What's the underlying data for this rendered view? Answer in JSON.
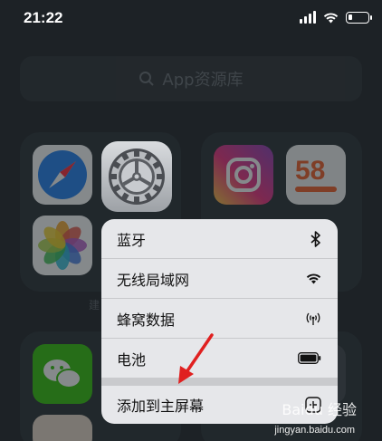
{
  "status_bar": {
    "time": "21:22"
  },
  "search": {
    "placeholder": "App资源库"
  },
  "folder_labels": {
    "left_partial": "建"
  },
  "menu": {
    "items": [
      {
        "label": "蓝牙",
        "icon": "bluetooth-icon"
      },
      {
        "label": "无线局域网",
        "icon": "wifi-icon"
      },
      {
        "label": "蜂窝数据",
        "icon": "cellular-icon"
      },
      {
        "label": "电池",
        "icon": "battery-icon"
      },
      {
        "label": "添加到主屏幕",
        "icon": "add-to-home-icon"
      }
    ]
  },
  "annotation": {
    "arrow_color": "#e02020"
  },
  "watermark": {
    "text": "Baidu 经验",
    "url": "jingyan.baidu.com"
  },
  "icons": {
    "safari": "safari-icon",
    "photos": "photos-icon",
    "instagram": "instagram-icon",
    "app58": "58-icon",
    "wechat": "wechat-icon",
    "settings": "settings-gear-icon"
  },
  "app58": {
    "label": "58"
  }
}
